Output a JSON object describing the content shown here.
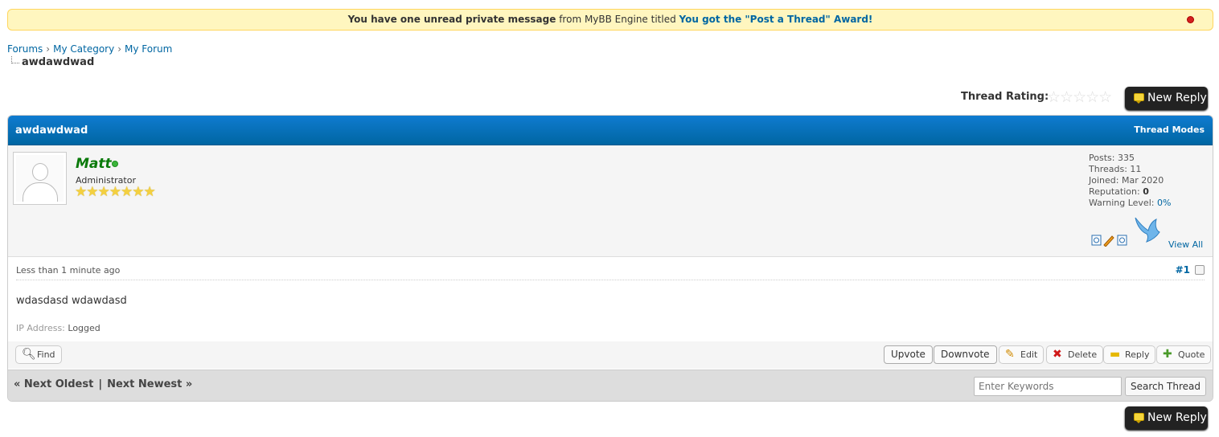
{
  "pm_notice": {
    "bold_text": "You have one unread private message",
    "middle_text": "from MyBB Engine titled",
    "link_text": "You got the \"Post a Thread\" Award!"
  },
  "breadcrumb": {
    "items": [
      "Forums",
      "My Category",
      "My Forum"
    ],
    "separator": "›",
    "active": "awdawdwad"
  },
  "thread_rating": {
    "label": "Thread Rating:",
    "stars": 5,
    "value": 0
  },
  "new_reply_label": "New Reply",
  "thread": {
    "title": "awdawdwad",
    "modes_label": "Thread Modes"
  },
  "author": {
    "username": "Matt",
    "username_color": "#0a7a0a",
    "status": "online",
    "usertitle": "Administrator",
    "stars": "★★★★★★★",
    "stats": {
      "posts_label": "Posts:",
      "posts": "335",
      "threads_label": "Threads:",
      "threads": "11",
      "joined_label": "Joined:",
      "joined": "Mar 2020",
      "reputation_label": "Reputation:",
      "reputation": "0",
      "warning_label": "Warning Level:",
      "warning": "0%"
    },
    "view_all_label": "View All"
  },
  "post": {
    "date": "Less than 1 minute ago",
    "number": "#1",
    "message": "wdasdasd wdawdasd",
    "ip_label": "IP Address:",
    "ip_value": "Logged"
  },
  "post_controls": {
    "find": "Find",
    "upvote": "Upvote",
    "downvote": "Downvote",
    "edit": "Edit",
    "delete": "Delete",
    "reply": "Reply",
    "quote": "Quote"
  },
  "footer": {
    "next_oldest": "« Next Oldest",
    "separator": "|",
    "next_newest": "Next Newest »",
    "search_placeholder": "Enter Keywords",
    "search_button": "Search Thread"
  }
}
